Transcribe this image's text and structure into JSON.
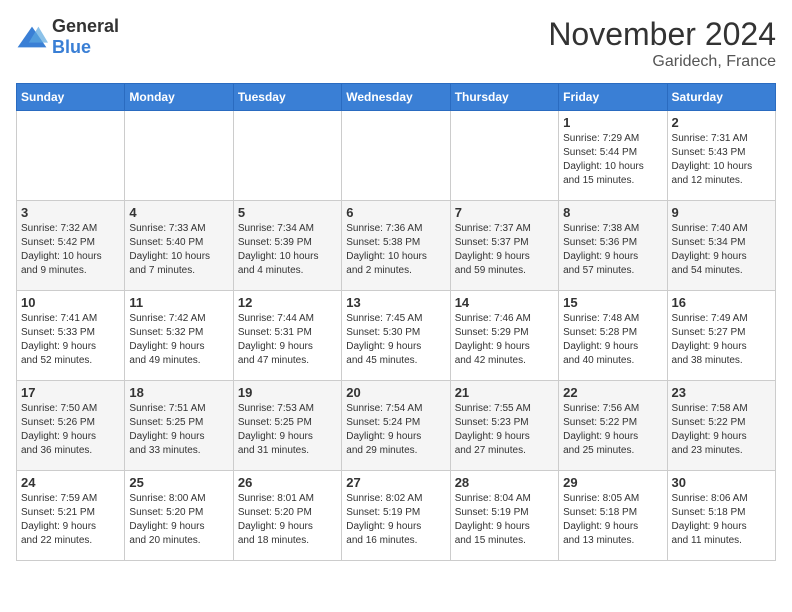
{
  "logo": {
    "general": "General",
    "blue": "Blue"
  },
  "header": {
    "month": "November 2024",
    "location": "Garidech, France"
  },
  "weekdays": [
    "Sunday",
    "Monday",
    "Tuesday",
    "Wednesday",
    "Thursday",
    "Friday",
    "Saturday"
  ],
  "weeks": [
    [
      {
        "day": "",
        "info": ""
      },
      {
        "day": "",
        "info": ""
      },
      {
        "day": "",
        "info": ""
      },
      {
        "day": "",
        "info": ""
      },
      {
        "day": "",
        "info": ""
      },
      {
        "day": "1",
        "info": "Sunrise: 7:29 AM\nSunset: 5:44 PM\nDaylight: 10 hours\nand 15 minutes."
      },
      {
        "day": "2",
        "info": "Sunrise: 7:31 AM\nSunset: 5:43 PM\nDaylight: 10 hours\nand 12 minutes."
      }
    ],
    [
      {
        "day": "3",
        "info": "Sunrise: 7:32 AM\nSunset: 5:42 PM\nDaylight: 10 hours\nand 9 minutes."
      },
      {
        "day": "4",
        "info": "Sunrise: 7:33 AM\nSunset: 5:40 PM\nDaylight: 10 hours\nand 7 minutes."
      },
      {
        "day": "5",
        "info": "Sunrise: 7:34 AM\nSunset: 5:39 PM\nDaylight: 10 hours\nand 4 minutes."
      },
      {
        "day": "6",
        "info": "Sunrise: 7:36 AM\nSunset: 5:38 PM\nDaylight: 10 hours\nand 2 minutes."
      },
      {
        "day": "7",
        "info": "Sunrise: 7:37 AM\nSunset: 5:37 PM\nDaylight: 9 hours\nand 59 minutes."
      },
      {
        "day": "8",
        "info": "Sunrise: 7:38 AM\nSunset: 5:36 PM\nDaylight: 9 hours\nand 57 minutes."
      },
      {
        "day": "9",
        "info": "Sunrise: 7:40 AM\nSunset: 5:34 PM\nDaylight: 9 hours\nand 54 minutes."
      }
    ],
    [
      {
        "day": "10",
        "info": "Sunrise: 7:41 AM\nSunset: 5:33 PM\nDaylight: 9 hours\nand 52 minutes."
      },
      {
        "day": "11",
        "info": "Sunrise: 7:42 AM\nSunset: 5:32 PM\nDaylight: 9 hours\nand 49 minutes."
      },
      {
        "day": "12",
        "info": "Sunrise: 7:44 AM\nSunset: 5:31 PM\nDaylight: 9 hours\nand 47 minutes."
      },
      {
        "day": "13",
        "info": "Sunrise: 7:45 AM\nSunset: 5:30 PM\nDaylight: 9 hours\nand 45 minutes."
      },
      {
        "day": "14",
        "info": "Sunrise: 7:46 AM\nSunset: 5:29 PM\nDaylight: 9 hours\nand 42 minutes."
      },
      {
        "day": "15",
        "info": "Sunrise: 7:48 AM\nSunset: 5:28 PM\nDaylight: 9 hours\nand 40 minutes."
      },
      {
        "day": "16",
        "info": "Sunrise: 7:49 AM\nSunset: 5:27 PM\nDaylight: 9 hours\nand 38 minutes."
      }
    ],
    [
      {
        "day": "17",
        "info": "Sunrise: 7:50 AM\nSunset: 5:26 PM\nDaylight: 9 hours\nand 36 minutes."
      },
      {
        "day": "18",
        "info": "Sunrise: 7:51 AM\nSunset: 5:25 PM\nDaylight: 9 hours\nand 33 minutes."
      },
      {
        "day": "19",
        "info": "Sunrise: 7:53 AM\nSunset: 5:25 PM\nDaylight: 9 hours\nand 31 minutes."
      },
      {
        "day": "20",
        "info": "Sunrise: 7:54 AM\nSunset: 5:24 PM\nDaylight: 9 hours\nand 29 minutes."
      },
      {
        "day": "21",
        "info": "Sunrise: 7:55 AM\nSunset: 5:23 PM\nDaylight: 9 hours\nand 27 minutes."
      },
      {
        "day": "22",
        "info": "Sunrise: 7:56 AM\nSunset: 5:22 PM\nDaylight: 9 hours\nand 25 minutes."
      },
      {
        "day": "23",
        "info": "Sunrise: 7:58 AM\nSunset: 5:22 PM\nDaylight: 9 hours\nand 23 minutes."
      }
    ],
    [
      {
        "day": "24",
        "info": "Sunrise: 7:59 AM\nSunset: 5:21 PM\nDaylight: 9 hours\nand 22 minutes."
      },
      {
        "day": "25",
        "info": "Sunrise: 8:00 AM\nSunset: 5:20 PM\nDaylight: 9 hours\nand 20 minutes."
      },
      {
        "day": "26",
        "info": "Sunrise: 8:01 AM\nSunset: 5:20 PM\nDaylight: 9 hours\nand 18 minutes."
      },
      {
        "day": "27",
        "info": "Sunrise: 8:02 AM\nSunset: 5:19 PM\nDaylight: 9 hours\nand 16 minutes."
      },
      {
        "day": "28",
        "info": "Sunrise: 8:04 AM\nSunset: 5:19 PM\nDaylight: 9 hours\nand 15 minutes."
      },
      {
        "day": "29",
        "info": "Sunrise: 8:05 AM\nSunset: 5:18 PM\nDaylight: 9 hours\nand 13 minutes."
      },
      {
        "day": "30",
        "info": "Sunrise: 8:06 AM\nSunset: 5:18 PM\nDaylight: 9 hours\nand 11 minutes."
      }
    ]
  ]
}
